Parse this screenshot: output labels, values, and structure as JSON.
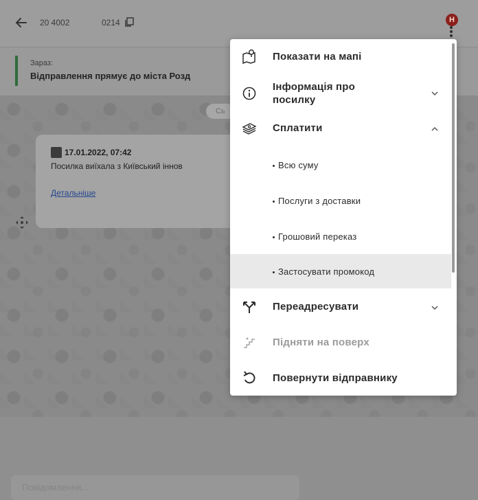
{
  "header": {
    "track_number": "20 4002",
    "track_number_suffix": "0214",
    "badge": "H"
  },
  "status": {
    "label": "Зараз:",
    "text": "Відправлення прямує до міста Розд"
  },
  "chat": {
    "date_pill": "Сь",
    "message": {
      "date": "17.01.2022, 07:42",
      "text": "Посилка виїхала з Київський іннов",
      "link": "Детальніше"
    },
    "compose_placeholder": "Повідомлення..."
  },
  "menu": {
    "items": [
      {
        "label": "Показати на мапі",
        "icon": "map-pin-icon"
      },
      {
        "label_line1": "Інформація про",
        "label_line2": "посилку",
        "icon": "info-icon",
        "chevron": "down"
      },
      {
        "label": "Сплатити",
        "icon": "money-icon",
        "chevron": "up"
      },
      {
        "label": "Всю суму"
      },
      {
        "label": "Послуги з доставки"
      },
      {
        "label": "Грошовий переказ"
      },
      {
        "label": "Застосувати промокод",
        "highlighted": true
      },
      {
        "label": "Переадресувати",
        "icon": "redirect-icon",
        "chevron": "down"
      },
      {
        "label": "Підняти на поверх",
        "icon": "stairs-icon",
        "disabled": true
      },
      {
        "label": "Повернути відправнику",
        "icon": "return-icon"
      }
    ]
  },
  "colors": {
    "badge_bg": "#8b1f1b",
    "status_accent": "#2e6b3c",
    "menu_highlight": "#e9e9e9",
    "disabled_text": "#9b9b9b"
  }
}
